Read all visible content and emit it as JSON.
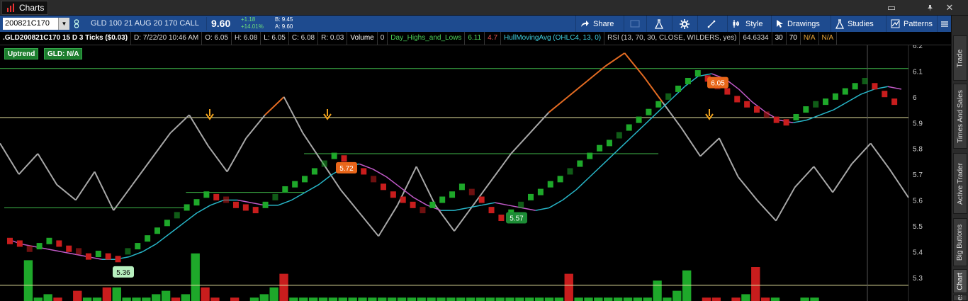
{
  "window": {
    "title": "Charts",
    "close_glyph": "✕",
    "pin_glyph": "📌",
    "restore_glyph": "▭"
  },
  "toolbar": {
    "symbol": "200821C170",
    "description": "GLD 100 21 AUG 20 170 CALL",
    "last": "9.60",
    "change": "+1.18",
    "change_pct": "+14.01%",
    "bid": "B: 9.45",
    "ask": "A: 9.60",
    "share": "Share",
    "style": "Style",
    "drawings": "Drawings",
    "studies": "Studies",
    "patterns": "Patterns"
  },
  "infobar": {
    "title": ".GLD200821C170 15 D 3 Ticks ($0.03)",
    "date": "D: 7/22/20 10:46 AM",
    "open": "O: 6.05",
    "high": "H: 6.08",
    "low": "L: 6.05",
    "close": "C: 6.08",
    "range": "R: 0.03",
    "volume_label": "Volume",
    "volume_value": "0",
    "study1": "Day_Highs_and_Lows",
    "study1_v1": "6.11",
    "study1_v2": "4.7",
    "study2": "HullMovingAvg (OHLC4, 13, 0)",
    "study3": "RSI (13, 70, 30, CLOSE, WILDERS, yes)",
    "study3_v": "64.6334",
    "study3_ob": "30",
    "study3_os": "70",
    "na1": "N/A",
    "na2": "N/A"
  },
  "badges": {
    "uptrend": "Uptrend",
    "gld": "GLD:  N/A"
  },
  "sidebar": [
    "Trade",
    "Times And Sales",
    "Active Trader",
    "Big Buttons",
    "Chart",
    "res"
  ],
  "colors": {
    "up": "#1ea82a",
    "down": "#c81d1d",
    "hull": "#27b6c8",
    "hull2": "#c25ac8",
    "rsi": "#a8a8a8",
    "rsi_hi": "#e36b22",
    "level": "#e8e4a0",
    "level_green": "#3fb84a",
    "arrow": "#f0a21c",
    "axis_text": "#cfcfcf"
  },
  "chart_data": {
    "type": "line",
    "title": "",
    "ylim": [
      5.25,
      6.2
    ],
    "y_ticks": [
      6.2,
      6.1,
      6.0,
      5.9,
      5.8,
      5.7,
      5.6,
      5.5,
      5.4,
      5.3
    ],
    "y_tick_labels": [
      "6.2",
      "6.1",
      "6",
      "5.9",
      "5.8",
      "5.7",
      "5.6",
      "5.5",
      "5.4",
      "5.3"
    ],
    "bricks": [
      5.44,
      5.43,
      5.41,
      5.42,
      5.44,
      5.43,
      5.41,
      5.4,
      5.38,
      5.39,
      5.38,
      5.37,
      5.4,
      5.42,
      5.45,
      5.48,
      5.51,
      5.54,
      5.57,
      5.59,
      5.62,
      5.61,
      5.6,
      5.58,
      5.57,
      5.56,
      5.58,
      5.61,
      5.64,
      5.66,
      5.68,
      5.71,
      5.74,
      5.77,
      5.76,
      5.73,
      5.71,
      5.68,
      5.65,
      5.62,
      5.6,
      5.58,
      5.56,
      5.58,
      5.6,
      5.62,
      5.65,
      5.63,
      5.6,
      5.56,
      5.53,
      5.55,
      5.58,
      5.61,
      5.63,
      5.66,
      5.68,
      5.71,
      5.74,
      5.77,
      5.8,
      5.82,
      5.85,
      5.88,
      5.91,
      5.94,
      5.97,
      6.0,
      6.03,
      6.06,
      6.09,
      6.07,
      6.04,
      6.02,
      5.99,
      5.97,
      5.95,
      5.93,
      5.91,
      5.9,
      5.92,
      5.95,
      5.97,
      5.98,
      6.0,
      6.02,
      6.04,
      6.06,
      6.04,
      6.01,
      5.98
    ],
    "brick_dirs": [
      "d",
      "d",
      "d",
      "u",
      "u",
      "d",
      "d",
      "d",
      "d",
      "u",
      "d",
      "d",
      "u",
      "u",
      "u",
      "u",
      "u",
      "u",
      "u",
      "u",
      "u",
      "d",
      "d",
      "d",
      "d",
      "d",
      "u",
      "u",
      "u",
      "u",
      "u",
      "u",
      "u",
      "u",
      "d",
      "d",
      "d",
      "d",
      "d",
      "d",
      "d",
      "d",
      "d",
      "u",
      "u",
      "u",
      "u",
      "d",
      "d",
      "d",
      "d",
      "u",
      "u",
      "u",
      "u",
      "u",
      "u",
      "u",
      "u",
      "u",
      "u",
      "u",
      "u",
      "u",
      "u",
      "u",
      "u",
      "u",
      "u",
      "u",
      "u",
      "d",
      "d",
      "d",
      "d",
      "d",
      "d",
      "d",
      "d",
      "d",
      "u",
      "u",
      "u",
      "u",
      "u",
      "u",
      "u",
      "u",
      "d",
      "d",
      "d"
    ],
    "hull": [
      5.45,
      5.43,
      5.42,
      5.41,
      5.4,
      5.39,
      5.38,
      5.37,
      5.37,
      5.38,
      5.4,
      5.43,
      5.47,
      5.51,
      5.55,
      5.58,
      5.6,
      5.6,
      5.59,
      5.58,
      5.58,
      5.6,
      5.63,
      5.66,
      5.7,
      5.73,
      5.74,
      5.72,
      5.69,
      5.65,
      5.61,
      5.58,
      5.56,
      5.56,
      5.57,
      5.58,
      5.59,
      5.58,
      5.57,
      5.56,
      5.57,
      5.6,
      5.64,
      5.69,
      5.74,
      5.79,
      5.84,
      5.89,
      5.94,
      5.99,
      6.04,
      6.08,
      6.09,
      6.07,
      6.03,
      5.98,
      5.94,
      5.91,
      5.9,
      5.91,
      5.93,
      5.95,
      5.98,
      6.01,
      6.03,
      6.04,
      6.03
    ],
    "rsi": [
      5.82,
      5.7,
      5.78,
      5.66,
      5.6,
      5.71,
      5.56,
      5.66,
      5.76,
      5.86,
      5.93,
      5.81,
      5.71,
      5.84,
      5.93,
      6.0,
      5.86,
      5.75,
      5.64,
      5.55,
      5.46,
      5.58,
      5.73,
      5.58,
      5.48,
      5.58,
      5.68,
      5.78,
      5.86,
      5.94,
      6.0,
      6.06,
      6.12,
      6.17,
      6.08,
      5.98,
      5.88,
      5.77,
      5.84,
      5.69,
      5.6,
      5.52,
      5.65,
      5.73,
      5.63,
      5.74,
      5.82,
      5.72,
      5.61
    ],
    "levels": [
      6.11,
      5.92,
      5.27
    ],
    "green_levels": [
      {
        "y": 5.57,
        "from": 0,
        "to": 0.2
      },
      {
        "y": 5.63,
        "from": 0.2,
        "to": 0.33
      },
      {
        "y": 5.78,
        "from": 0.33,
        "to": 0.72
      }
    ],
    "labels": [
      {
        "text": "5.36",
        "value": 5.36,
        "kind": "low"
      },
      {
        "text": "5.72",
        "value": 5.72,
        "kind": "high"
      },
      {
        "text": "5.57",
        "value": 5.57,
        "kind": "low"
      },
      {
        "text": "6.05",
        "value": 6.05,
        "kind": "high"
      }
    ],
    "volume": [
      0,
      0,
      12,
      1,
      2,
      1,
      0,
      3,
      1,
      1,
      4,
      4,
      1,
      1,
      1,
      2,
      3,
      1,
      2,
      14,
      4,
      1,
      0,
      1,
      0,
      1,
      2,
      4,
      8,
      1,
      1,
      1,
      1,
      1,
      1,
      1,
      1,
      1,
      1,
      1,
      1,
      1,
      1,
      1,
      1,
      1,
      1,
      1,
      1,
      1,
      1,
      1,
      1,
      1,
      1,
      1,
      1,
      8,
      1,
      1,
      1,
      1,
      1,
      1,
      1,
      1,
      6,
      1,
      3,
      9,
      0,
      1,
      1,
      0,
      1,
      2,
      10,
      1,
      1,
      0,
      0,
      1,
      1,
      0,
      0,
      0,
      0,
      0,
      0,
      0,
      0,
      0
    ],
    "volume_colors": [
      "u",
      "u",
      "u",
      "u",
      "u",
      "d",
      "u",
      "d",
      "u",
      "u",
      "d",
      "u",
      "u",
      "u",
      "u",
      "u",
      "u",
      "d",
      "u",
      "u",
      "d",
      "d",
      "u",
      "d",
      "u",
      "u",
      "u",
      "u",
      "d",
      "u",
      "u",
      "u",
      "u",
      "u",
      "u",
      "u",
      "u",
      "u",
      "u",
      "u",
      "u",
      "u",
      "u",
      "u",
      "u",
      "u",
      "u",
      "u",
      "u",
      "u",
      "u",
      "u",
      "u",
      "u",
      "u",
      "u",
      "u",
      "d",
      "u",
      "u",
      "u",
      "u",
      "u",
      "u",
      "u",
      "u",
      "u",
      "u",
      "u",
      "u",
      "u",
      "d",
      "d",
      "u",
      "d",
      "u",
      "d",
      "d",
      "u",
      "u",
      "u",
      "u",
      "u",
      "u",
      "u",
      "u",
      "u",
      "u",
      "u",
      "u",
      "u"
    ]
  }
}
